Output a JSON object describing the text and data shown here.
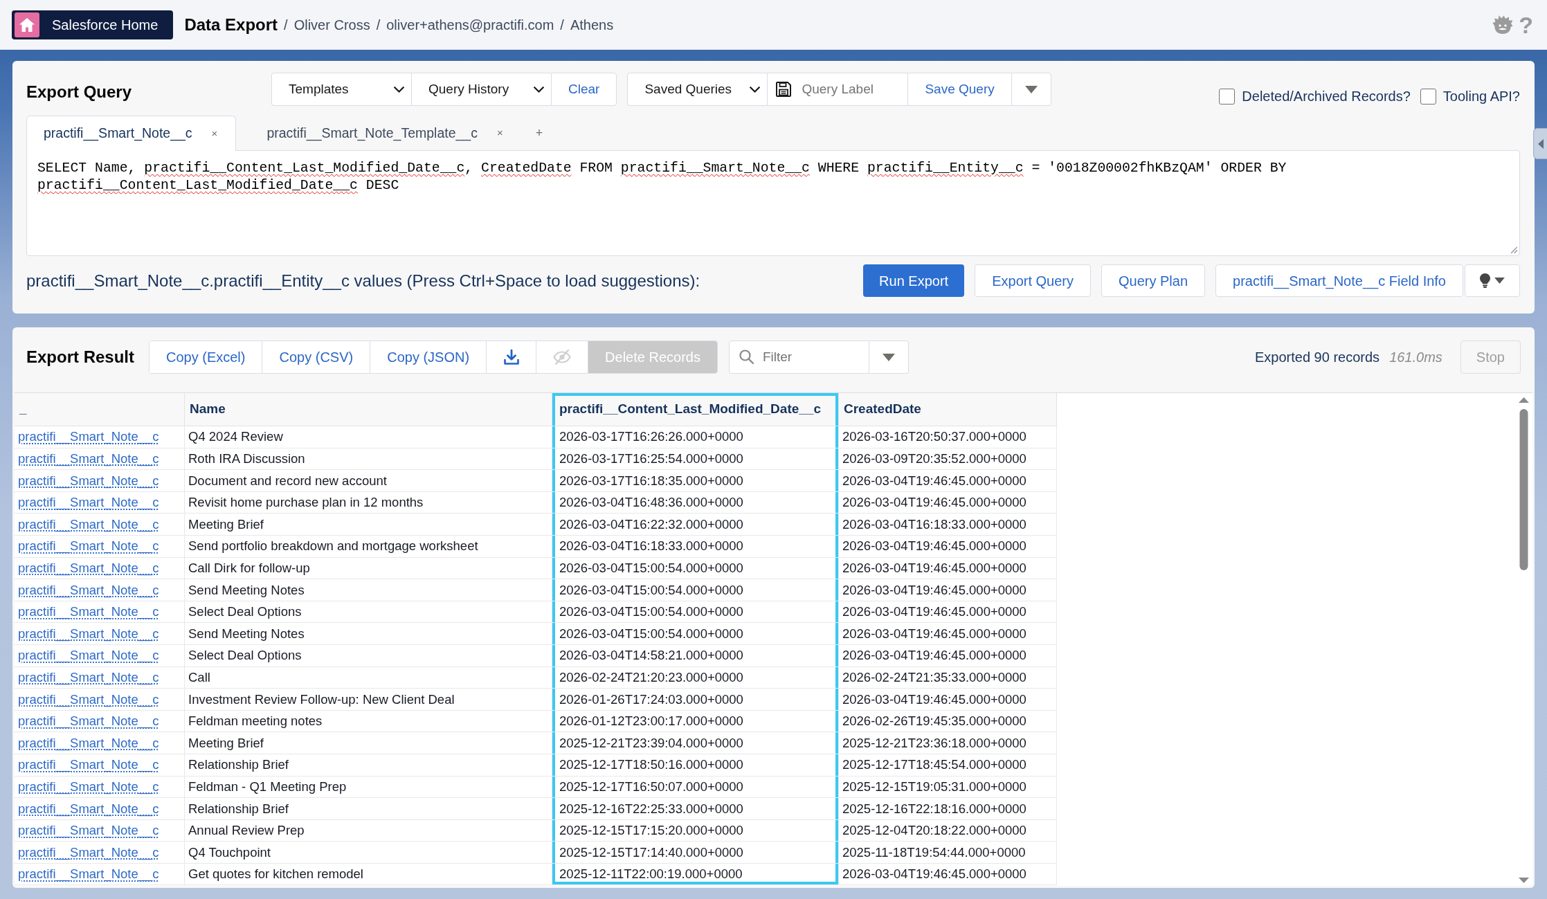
{
  "header": {
    "home_button": {
      "label": "Salesforce Home"
    },
    "title": "Data Export",
    "breadcrumbs": [
      {
        "separator": "/",
        "label": "Oliver Cross"
      },
      {
        "separator": "/",
        "label": "oliver+athens@practifi.com"
      },
      {
        "separator": "/",
        "label": "Athens"
      }
    ],
    "help": "?"
  },
  "export_query": {
    "title": "Export Query",
    "toolbar_groups": [
      {
        "items": [
          {
            "kind": "select",
            "label": "Templates"
          },
          {
            "kind": "select",
            "label": "Query History"
          },
          {
            "kind": "link",
            "label": "Clear"
          }
        ]
      },
      {
        "items": [
          {
            "kind": "select",
            "label": "Saved Queries"
          },
          {
            "kind": "input",
            "placeholder": "Query Label"
          },
          {
            "kind": "link",
            "label": "Save Query"
          },
          {
            "kind": "menu"
          }
        ]
      }
    ],
    "options": [
      {
        "label": "Deleted/Archived Records?",
        "checked": false
      },
      {
        "label": "Tooling API?",
        "checked": false
      }
    ],
    "tabs": [
      {
        "label": "practifi__Smart_Note__c",
        "close": "×",
        "selected": true
      },
      {
        "label": "practifi__Smart_Note_Template__c",
        "close": "×",
        "selected": false
      }
    ],
    "add_tab": "+",
    "query": [
      {
        "text": "SELECT Name, ",
        "misspelled": false
      },
      {
        "text": "practifi__Content_Last_Modified_Date__c",
        "misspelled": true
      },
      {
        "text": ", ",
        "misspelled": false
      },
      {
        "text": "CreatedDate",
        "misspelled": true
      },
      {
        "text": " FROM ",
        "misspelled": false
      },
      {
        "text": "practifi__Smart_Note__c",
        "misspelled": true
      },
      {
        "text": " WHERE ",
        "misspelled": false
      },
      {
        "text": "practifi__Entity__c",
        "misspelled": true
      },
      {
        "text": " = '0018Z00002fhKBzQAM' ORDER BY ",
        "misspelled": false
      },
      {
        "text": "practifi__Content_Last_Modified_Date__c",
        "misspelled": true
      },
      {
        "text": " DESC",
        "misspelled": false
      }
    ],
    "hint": "practifi__Smart_Note__c.practifi__Entity__c values (Press Ctrl+Space to load suggestions):",
    "actions": [
      {
        "kind": "primary",
        "label": "Run Export"
      },
      {
        "kind": "secondary",
        "label": "Export Query"
      },
      {
        "kind": "secondary",
        "label": "Query Plan"
      },
      {
        "kind": "secondary",
        "label": "practifi__Smart_Note__c Field Info"
      },
      {
        "kind": "menu"
      }
    ]
  },
  "export_result": {
    "title": "Export Result",
    "toolbar": [
      {
        "kind": "text",
        "label": "Copy (Excel)",
        "disabled": false
      },
      {
        "kind": "text",
        "label": "Copy (CSV)",
        "disabled": false
      },
      {
        "kind": "text",
        "label": "Copy (JSON)",
        "disabled": false
      },
      {
        "kind": "download",
        "disabled": false
      },
      {
        "kind": "hide",
        "disabled": true
      },
      {
        "kind": "text",
        "label": "Delete Records",
        "disabled": true
      }
    ],
    "filter": {
      "placeholder": "Filter"
    },
    "status": "Exported 90 records",
    "timing": "161.0ms",
    "stop": {
      "label": "Stop",
      "disabled": true
    },
    "table": {
      "columns": [
        {
          "label": "_",
          "kind": "link",
          "selected": false
        },
        {
          "label": "Name",
          "kind": "text",
          "selected": false
        },
        {
          "label": "practifi__Content_Last_Modified_Date__c",
          "kind": "text",
          "selected": true
        },
        {
          "label": "CreatedDate",
          "kind": "text",
          "selected": false
        }
      ],
      "rows": [
        {
          "cells": [
            "practifi__Smart_Note__c",
            "Q4 2024 Review",
            "2026-03-17T16:26:26.000+0000",
            "2026-03-16T20:50:37.000+0000"
          ]
        },
        {
          "cells": [
            "practifi__Smart_Note__c",
            "Roth IRA Discussion",
            "2026-03-17T16:25:54.000+0000",
            "2026-03-09T20:35:52.000+0000"
          ]
        },
        {
          "cells": [
            "practifi__Smart_Note__c",
            "Document and record new account",
            "2026-03-17T16:18:35.000+0000",
            "2026-03-04T19:46:45.000+0000"
          ]
        },
        {
          "cells": [
            "practifi__Smart_Note__c",
            "Revisit home purchase plan in 12 months",
            "2026-03-04T16:48:36.000+0000",
            "2026-03-04T19:46:45.000+0000"
          ]
        },
        {
          "cells": [
            "practifi__Smart_Note__c",
            "Meeting Brief",
            "2026-03-04T16:22:32.000+0000",
            "2026-03-04T16:18:33.000+0000"
          ]
        },
        {
          "cells": [
            "practifi__Smart_Note__c",
            "Send portfolio breakdown and mortgage worksheet",
            "2026-03-04T16:18:33.000+0000",
            "2026-03-04T19:46:45.000+0000"
          ]
        },
        {
          "cells": [
            "practifi__Smart_Note__c",
            "Call Dirk for follow-up",
            "2026-03-04T15:00:54.000+0000",
            "2026-03-04T19:46:45.000+0000"
          ]
        },
        {
          "cells": [
            "practifi__Smart_Note__c",
            "Send Meeting Notes",
            "2026-03-04T15:00:54.000+0000",
            "2026-03-04T19:46:45.000+0000"
          ]
        },
        {
          "cells": [
            "practifi__Smart_Note__c",
            "Select Deal Options",
            "2026-03-04T15:00:54.000+0000",
            "2026-03-04T19:46:45.000+0000"
          ]
        },
        {
          "cells": [
            "practifi__Smart_Note__c",
            "Send Meeting Notes",
            "2026-03-04T15:00:54.000+0000",
            "2026-03-04T19:46:45.000+0000"
          ]
        },
        {
          "cells": [
            "practifi__Smart_Note__c",
            "Select Deal Options",
            "2026-03-04T14:58:21.000+0000",
            "2026-03-04T19:46:45.000+0000"
          ]
        },
        {
          "cells": [
            "practifi__Smart_Note__c",
            "Call",
            "2026-02-24T21:20:23.000+0000",
            "2026-02-24T21:35:33.000+0000"
          ]
        },
        {
          "cells": [
            "practifi__Smart_Note__c",
            "Investment Review Follow-up: New Client Deal",
            "2026-01-26T17:24:03.000+0000",
            "2026-03-04T19:46:45.000+0000"
          ]
        },
        {
          "cells": [
            "practifi__Smart_Note__c",
            "Feldman meeting notes",
            "2026-01-12T23:00:17.000+0000",
            "2026-02-26T19:45:35.000+0000"
          ]
        },
        {
          "cells": [
            "practifi__Smart_Note__c",
            "Meeting Brief",
            "2025-12-21T23:39:04.000+0000",
            "2025-12-21T23:36:18.000+0000"
          ]
        },
        {
          "cells": [
            "practifi__Smart_Note__c",
            "Relationship Brief",
            "2025-12-17T18:50:16.000+0000",
            "2025-12-17T18:45:54.000+0000"
          ]
        },
        {
          "cells": [
            "practifi__Smart_Note__c",
            "Feldman - Q1 Meeting Prep",
            "2025-12-17T16:50:07.000+0000",
            "2025-12-15T19:05:31.000+0000"
          ]
        },
        {
          "cells": [
            "practifi__Smart_Note__c",
            "Relationship Brief",
            "2025-12-16T22:25:33.000+0000",
            "2025-12-16T22:18:16.000+0000"
          ]
        },
        {
          "cells": [
            "practifi__Smart_Note__c",
            "Annual Review Prep",
            "2025-12-15T17:15:20.000+0000",
            "2025-12-04T20:18:22.000+0000"
          ]
        },
        {
          "cells": [
            "practifi__Smart_Note__c",
            "Q4 Touchpoint",
            "2025-12-15T17:14:40.000+0000",
            "2025-11-18T19:54:44.000+0000"
          ]
        },
        {
          "cells": [
            "practifi__Smart_Note__c",
            "Get quotes for kitchen remodel",
            "2025-12-11T22:00:19.000+0000",
            "2026-03-04T19:46:45.000+0000"
          ]
        }
      ]
    }
  }
}
